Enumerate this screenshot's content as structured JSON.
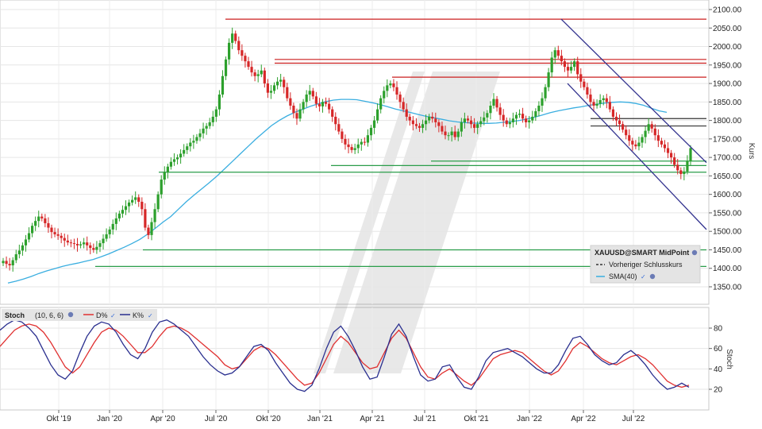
{
  "chart_data": [
    {
      "type": "candlestick",
      "instrument": "XAUUSD@SMART MidPoint",
      "ylabel": "Kurs",
      "ylim": [
        1300,
        2110
      ],
      "y_ticks": [
        "2100.00",
        "2050.00",
        "2000.00",
        "1950.00",
        "1900.00",
        "1850.00",
        "1800.00",
        "1750.00",
        "1700.00",
        "1650.00",
        "1600.00",
        "1550.00",
        "1500.00",
        "1450.00",
        "1400.00",
        "1350.00"
      ],
      "x_ticks": [
        "Okt '19",
        "Jan '20",
        "Apr '20",
        "Jul '20",
        "Okt '20",
        "Jan '21",
        "Apr '21",
        "Jul '21",
        "Okt '21",
        "Jan '22",
        "Apr '22",
        "Jul '22"
      ],
      "colors": {
        "up": "#2ca02c",
        "down": "#d62728",
        "sma": "#3aaee0",
        "channel": "#33338f",
        "resistance": "#cc1f1f",
        "support": "#2a9d4a",
        "prev_close": "#333333"
      },
      "legend": {
        "title": "XAUUSD@SMART MidPoint",
        "prev_close_label": "Vorheriger Schlusskurs",
        "sma_label": "SMA(40)"
      },
      "price_closes": [
        1420,
        1412,
        1408,
        1422,
        1438,
        1448,
        1462,
        1478,
        1495,
        1515,
        1528,
        1540,
        1535,
        1522,
        1510,
        1498,
        1492,
        1488,
        1482,
        1475,
        1470,
        1468,
        1466,
        1462,
        1465,
        1470,
        1462,
        1455,
        1450,
        1458,
        1468,
        1480,
        1492,
        1505,
        1520,
        1535,
        1548,
        1558,
        1568,
        1578,
        1585,
        1592,
        1580,
        1560,
        1510,
        1490,
        1525,
        1560,
        1600,
        1640,
        1660,
        1675,
        1688,
        1695,
        1700,
        1710,
        1720,
        1730,
        1740,
        1745,
        1755,
        1765,
        1778,
        1785,
        1795,
        1810,
        1830,
        1870,
        1920,
        1965,
        2010,
        2035,
        2015,
        1990,
        1975,
        1960,
        1945,
        1930,
        1920,
        1925,
        1935,
        1900,
        1875,
        1880,
        1895,
        1905,
        1910,
        1890,
        1860,
        1840,
        1820,
        1805,
        1830,
        1850,
        1870,
        1880,
        1865,
        1845,
        1838,
        1850,
        1845,
        1830,
        1810,
        1790,
        1770,
        1750,
        1735,
        1728,
        1720,
        1725,
        1735,
        1742,
        1740,
        1760,
        1780,
        1800,
        1830,
        1860,
        1880,
        1895,
        1900,
        1890,
        1870,
        1850,
        1830,
        1810,
        1800,
        1790,
        1785,
        1780,
        1790,
        1800,
        1810,
        1805,
        1795,
        1785,
        1770,
        1760,
        1760,
        1770,
        1755,
        1770,
        1795,
        1805,
        1800,
        1790,
        1780,
        1790,
        1798,
        1808,
        1820,
        1840,
        1858,
        1835,
        1815,
        1800,
        1790,
        1795,
        1805,
        1815,
        1818,
        1805,
        1795,
        1800,
        1810,
        1825,
        1840,
        1860,
        1890,
        1930,
        1970,
        1990,
        1975,
        1960,
        1945,
        1935,
        1945,
        1960,
        1925,
        1905,
        1890,
        1870,
        1850,
        1840,
        1845,
        1855,
        1860,
        1850,
        1830,
        1810,
        1800,
        1790,
        1775,
        1760,
        1745,
        1735,
        1730,
        1740,
        1755,
        1772,
        1790,
        1778,
        1760,
        1745,
        1735,
        1725,
        1712,
        1700,
        1680,
        1665,
        1655,
        1662,
        1690,
        1725
      ],
      "sma40": [
        1360,
        1365,
        1371,
        1378,
        1386,
        1393,
        1399,
        1405,
        1410,
        1414,
        1419,
        1424,
        1431,
        1439,
        1448,
        1457,
        1467,
        1478,
        1492,
        1508,
        1525,
        1540,
        1560,
        1580,
        1598,
        1615,
        1632,
        1650,
        1670,
        1690,
        1710,
        1730,
        1750,
        1768,
        1786,
        1800,
        1812,
        1822,
        1830,
        1838,
        1845,
        1851,
        1855,
        1857,
        1857,
        1856,
        1852,
        1848,
        1843,
        1837,
        1831,
        1826,
        1821,
        1816,
        1811,
        1807,
        1803,
        1799,
        1796,
        1794,
        1793,
        1792,
        1792,
        1793,
        1795,
        1797,
        1800,
        1804,
        1809,
        1815,
        1821,
        1826,
        1830,
        1834,
        1837,
        1841,
        1844,
        1847,
        1849,
        1850,
        1849,
        1846,
        1841,
        1833,
        1826,
        1822
      ],
      "channel_upper": [
        [
          2074,
          2067
        ],
        [
          1755,
          2050
        ]
      ],
      "channel_lower": [
        [
          2071,
          1900
        ],
        [
          1505,
          2050
        ]
      ],
      "resistance_levels": [
        2074,
        1965,
        1955,
        1917,
        1805,
        1785
      ],
      "support_levels": [
        1690,
        1678,
        1660,
        1450,
        1405
      ]
    },
    {
      "type": "line",
      "title": "Stoch",
      "params": "(10, 6, 6)",
      "ylabel": "Stoch",
      "ylim": [
        0,
        100
      ],
      "y_ticks": [
        "80",
        "60",
        "40",
        "20"
      ],
      "series": [
        {
          "name": "D%",
          "color": "#e03030",
          "values": [
            62,
            70,
            78,
            82,
            84,
            82,
            76,
            66,
            54,
            42,
            36,
            42,
            54,
            66,
            76,
            80,
            78,
            72,
            64,
            56,
            56,
            62,
            72,
            80,
            82,
            80,
            76,
            70,
            64,
            58,
            52,
            44,
            40,
            42,
            50,
            58,
            62,
            60,
            54,
            46,
            38,
            30,
            24,
            26,
            36,
            50,
            64,
            72,
            66,
            56,
            46,
            40,
            42,
            56,
            70,
            78,
            70,
            56,
            42,
            32,
            30,
            36,
            40,
            34,
            28,
            24,
            30,
            40,
            50,
            54,
            56,
            58,
            56,
            50,
            44,
            38,
            34,
            38,
            48,
            60,
            66,
            62,
            56,
            50,
            46,
            44,
            48,
            52,
            54,
            50,
            44,
            36,
            28,
            24,
            22,
            24
          ]
        },
        {
          "name": "K%",
          "color": "#2a2f8f",
          "values": [
            78,
            84,
            88,
            86,
            80,
            72,
            58,
            44,
            34,
            30,
            38,
            56,
            72,
            82,
            86,
            84,
            76,
            64,
            54,
            50,
            60,
            76,
            86,
            88,
            84,
            78,
            72,
            62,
            52,
            44,
            38,
            34,
            36,
            42,
            52,
            62,
            64,
            58,
            46,
            36,
            26,
            20,
            18,
            24,
            40,
            60,
            76,
            82,
            72,
            58,
            42,
            30,
            32,
            52,
            74,
            84,
            72,
            52,
            34,
            28,
            30,
            42,
            44,
            32,
            22,
            20,
            32,
            48,
            56,
            58,
            60,
            56,
            52,
            46,
            40,
            36,
            36,
            44,
            58,
            70,
            72,
            64,
            54,
            48,
            44,
            46,
            54,
            58,
            52,
            44,
            34,
            26,
            20,
            22,
            26,
            22
          ]
        }
      ]
    }
  ]
}
